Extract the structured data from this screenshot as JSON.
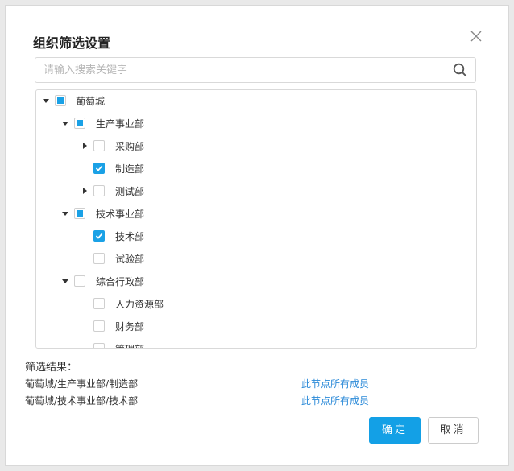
{
  "dialog": {
    "title": "组织筛选设置",
    "search_placeholder": "请输入搜索关键字",
    "tree": [
      {
        "label": "葡萄城",
        "level": 0,
        "expand": "expanded",
        "check": "partial"
      },
      {
        "label": "生产事业部",
        "level": 1,
        "expand": "expanded",
        "check": "partial"
      },
      {
        "label": "采购部",
        "level": 2,
        "expand": "collapsed",
        "check": "unchecked"
      },
      {
        "label": "制造部",
        "level": 2,
        "expand": "none",
        "check": "checked"
      },
      {
        "label": "测试部",
        "level": 2,
        "expand": "collapsed",
        "check": "unchecked"
      },
      {
        "label": "技术事业部",
        "level": 1,
        "expand": "expanded",
        "check": "partial"
      },
      {
        "label": "技术部",
        "level": 2,
        "expand": "none",
        "check": "checked"
      },
      {
        "label": "试验部",
        "level": 2,
        "expand": "none",
        "check": "unchecked"
      },
      {
        "label": "综合行政部",
        "level": 1,
        "expand": "expanded",
        "check": "unchecked"
      },
      {
        "label": "人力资源部",
        "level": 2,
        "expand": "none",
        "check": "unchecked"
      },
      {
        "label": "财务部",
        "level": 2,
        "expand": "none",
        "check": "unchecked"
      },
      {
        "label": "管理部",
        "level": 2,
        "expand": "none",
        "check": "unchecked"
      }
    ],
    "result_title": "筛选结果：",
    "results": [
      {
        "path": "葡萄城/生产事业部/制造部",
        "scope": "此节点所有成员"
      },
      {
        "path": "葡萄城/技术事业部/技术部",
        "scope": "此节点所有成员"
      }
    ],
    "ok_label": "确定",
    "cancel_label": "取消"
  },
  "colors": {
    "accent": "#13a0e6",
    "link": "#2b8ad8"
  },
  "icons": {
    "close": "close-icon",
    "search": "search-icon",
    "expanded": "caret-down-icon",
    "collapsed": "caret-right-icon",
    "checked": "checkmark-icon"
  }
}
